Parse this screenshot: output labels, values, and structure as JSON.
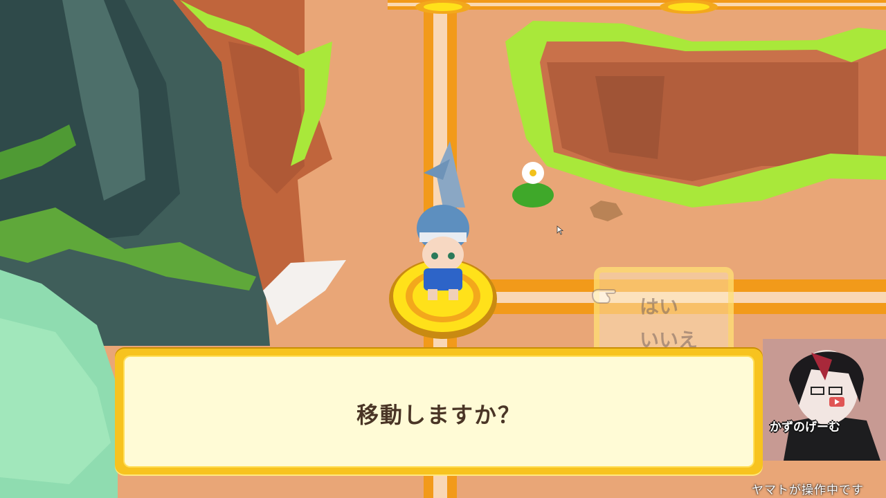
{
  "dialog": {
    "message": "移動しますか？"
  },
  "choice_menu": {
    "options": [
      {
        "label": "はい",
        "highlighted": true
      },
      {
        "label": "いいえ",
        "highlighted": false
      }
    ],
    "pointer_icon": "pointing-hand-icon"
  },
  "stream_overlay": {
    "channel_name": "かずのげーむ",
    "operator_status": "ヤマトが操作中です"
  },
  "colors": {
    "dialog_frame": "#f7c31f",
    "dialog_fill": "#fffbd6",
    "dialog_text": "#4a3526",
    "path_orange": "#f29a1a",
    "grass_green": "#a9e83a",
    "space_yellow": "#ffe11a"
  }
}
